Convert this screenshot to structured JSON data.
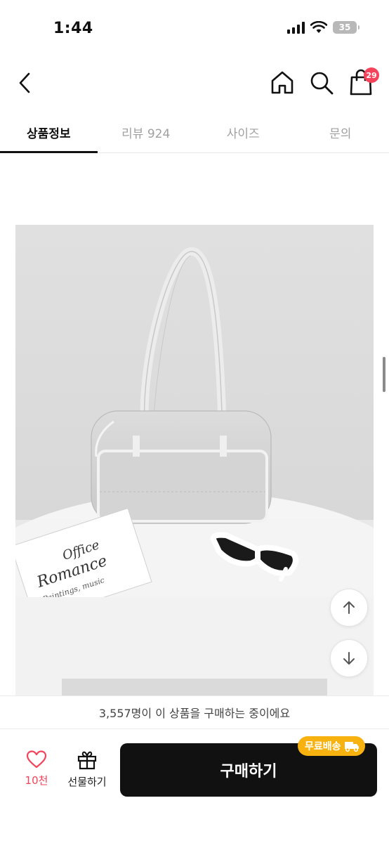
{
  "status": {
    "time": "1:44",
    "battery": "35"
  },
  "header": {
    "cart_count": "29"
  },
  "tabs": [
    {
      "label": "상품정보",
      "active": true
    },
    {
      "label": "리뷰 924",
      "active": false
    },
    {
      "label": "사이즈",
      "active": false
    },
    {
      "label": "문의",
      "active": false
    }
  ],
  "product_image": {
    "book_title_line1": "Office",
    "book_title_line2": "Romance",
    "book_subtitle": "Paintings, music"
  },
  "buying_banner": "3,557명이 이 상품을 구매하는 중이에요",
  "bottom": {
    "like_count": "10천",
    "gift_label": "선물하기",
    "buy_label": "구매하기",
    "free_shipping": "무료배송"
  },
  "colors": {
    "accent": "#f5435b",
    "buy_button": "#111111",
    "free_ship": "#f7b20f"
  }
}
